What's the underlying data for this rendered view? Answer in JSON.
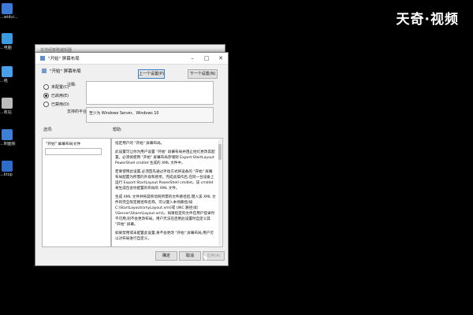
{
  "watermark": "天奇·视频",
  "desktop": {
    "icons": [
      {
        "name": "desktop-icon-1",
        "caption": "...widui...",
        "color": "#3b7ad6"
      },
      {
        "name": "desktop-icon-2",
        "caption": "...电脑",
        "color": "#3b9be0"
      },
      {
        "name": "desktop-icon-3",
        "caption": "...络",
        "color": "#4aa0e8"
      },
      {
        "name": "desktop-icon-4",
        "caption": "...收站",
        "color": "#bbbbbb"
      },
      {
        "name": "desktop-icon-5",
        "caption": "...制面板",
        "color": "#3d7fd6"
      },
      {
        "name": "desktop-icon-6",
        "caption": "...ktop",
        "color": "#2d6cc9"
      }
    ]
  },
  "bg_window": {
    "title": "本地组策略编辑器"
  },
  "dialog": {
    "title": "\"开始\" 屏幕布局",
    "header_label": "\"开始\" 屏幕布局",
    "prev_button": "上一个设置(P)",
    "next_button": "下一个设置(N)",
    "radios": [
      {
        "label": "未配置(C)",
        "checked": false
      },
      {
        "label": "已启用(E)",
        "checked": true
      },
      {
        "label": "已禁用(D)",
        "checked": false
      }
    ],
    "comment_label": "注释:",
    "supported_label": "支持的平台:",
    "supported_value": "至少为 Windows Server、Windows 10",
    "options_label": "选项:",
    "help_label": "帮助:",
    "option_field_label": "\"开始\" 屏幕布局文件",
    "option_field_value": "",
    "help_paragraphs": [
      "指定用户的 \"开始\" 屏幕布局。",
      "此设置可让你为用户设置 \"开始\" 屏幕布局并阻止他们更改其配置。必须将使用 \"开始\" 屏幕布局存储到 Export-StartLayout PowerShell cmdlet 生成的 XML 文件中。",
      "若要使用此设置,必须首先通过手动方式将设备的 \"开始\" 屏幕布局配置为所需的外观和感觉。完成此操作后,在同一台设备上运行 Export-StartLayout PowerShell cmdlet。该 cmdlet 将生成包含你配置的布局的 XML 文件。",
      "生成 XML 文件并将其移动到所需的文件路径后,键入该 XML 文件的完全限定路径和名称。可以键入本地路径(如 C:\\StartLayouts\\myLayout.xml)或 UNC 路径(如 \\\\Server\\Share\\Layout.xml)。如果指定的文件在用户登录时不可用,则不会更改布局。用户无法在启用此设置时自定义其 \"开始\" 屏幕。",
      "如果禁用或未配置此设置,将不会更改 \"开始\" 屏幕布局,用户可以对布局进行自定义。"
    ],
    "ok_button": "确定",
    "cancel_button": "取消",
    "apply_button": "应用(A)"
  }
}
